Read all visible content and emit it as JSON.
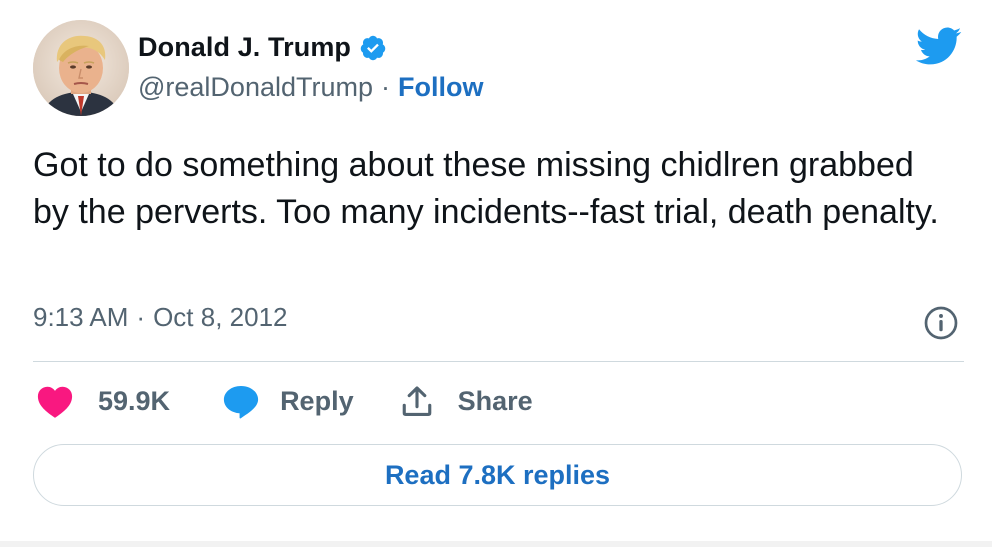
{
  "author": {
    "display_name": "Donald J. Trump",
    "handle": "@realDonaldTrump",
    "separator": "·",
    "follow_label": "Follow",
    "verified": true,
    "avatar_icon": "avatar-portrait"
  },
  "tweet": {
    "text": "Got to do something about these missing chidlren grabbed by the perverts. Too many incidents--fast trial, death penalty.",
    "time": "9:13 AM",
    "separator": "·",
    "date": "Oct 8, 2012"
  },
  "actions": {
    "likes": "59.9K",
    "reply_label": "Reply",
    "share_label": "Share"
  },
  "read_replies_label": "Read 7.8K replies",
  "colors": {
    "twitter_blue": "#1d9bf0",
    "link_blue": "#1d6fc1",
    "heart_pink": "#f91880",
    "secondary_text": "#536471",
    "divider": "#cfd9de"
  },
  "icons": {
    "brand": "twitter-bird-icon",
    "verified": "verified-badge-icon",
    "info": "info-icon",
    "like": "heart-icon",
    "reply": "reply-bubble-icon",
    "share": "share-upload-icon"
  }
}
